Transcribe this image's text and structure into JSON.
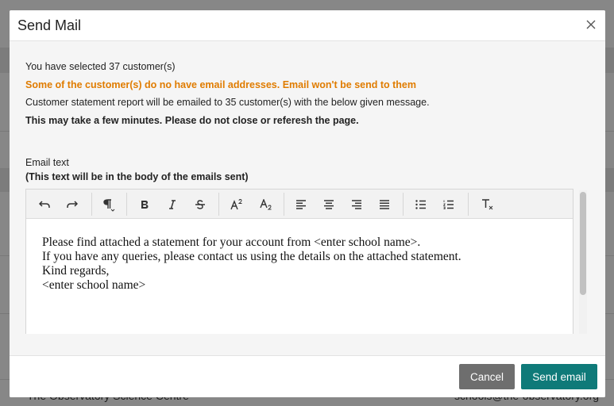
{
  "modal": {
    "title": "Send Mail",
    "selected_text": "You have selected 37 customer(s)",
    "warning_text": "Some of the customer(s) do no have email addresses. Email won't be send to them",
    "info_text": "Customer statement report will be emailed to 35 customer(s) with the below given message.",
    "notice_text": "This may take a few minutes. Please do not close or referesh the page.",
    "email_label": "Email text",
    "email_sublabel": "(This text will be in the body of the emails sent)",
    "editor_lines": [
      "Please find attached a statement for your account from <enter school name>.",
      "If you have any queries, please contact us using the details on the attached statement.",
      "Kind regards,",
      "<enter school name>"
    ],
    "cancel_label": "Cancel",
    "send_label": "Send email",
    "close_icon": "close-icon"
  },
  "toolbar_icons": [
    "undo-icon",
    "redo-icon",
    "paragraph-format-icon",
    "bold-icon",
    "italic-icon",
    "strikethrough-icon",
    "superscript-icon",
    "subscript-icon",
    "align-left-icon",
    "align-center-icon",
    "align-right-icon",
    "align-justify-icon",
    "bulleted-list-icon",
    "numbered-list-icon",
    "clear-formatting-icon"
  ],
  "background": {
    "footer_name": "The Observatory Science Centre",
    "footer_email": "schools@the-observatory.org"
  },
  "colors": {
    "accent": "#0f7a79",
    "warning": "#e07c00",
    "cancel": "#6e6e6e"
  }
}
